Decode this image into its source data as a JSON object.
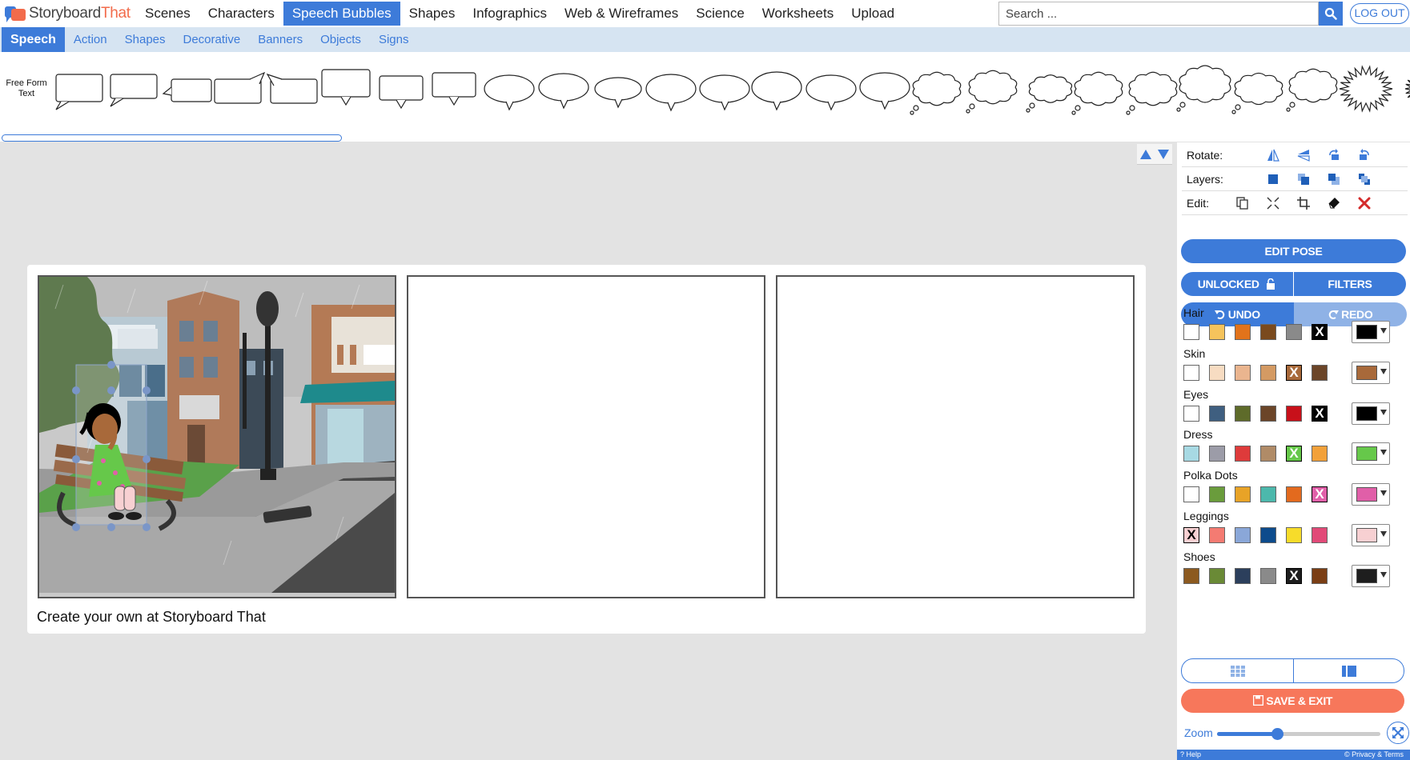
{
  "brand": {
    "name_part1": "Storyboard",
    "name_part2": "That"
  },
  "topnav": {
    "items": [
      "Scenes",
      "Characters",
      "Speech Bubbles",
      "Shapes",
      "Infographics",
      "Web & Wireframes",
      "Science",
      "Worksheets",
      "Upload"
    ],
    "active": "Speech Bubbles",
    "search_placeholder": "Search ...",
    "logout_label": "LOG OUT"
  },
  "subnav": {
    "items": [
      "Speech",
      "Action",
      "Shapes",
      "Decorative",
      "Banners",
      "Objects",
      "Signs"
    ],
    "active": "Speech"
  },
  "library": {
    "freeform_label": "Free Form Text"
  },
  "board": {
    "watermark": "Create your own at Storyboard That"
  },
  "panel": {
    "rotate_label": "Rotate:",
    "layers_label": "Layers:",
    "edit_label": "Edit:",
    "edit_pose": "EDIT POSE",
    "unlocked": "UNLOCKED",
    "filters": "FILTERS",
    "undo": "UNDO",
    "redo": "REDO",
    "save_exit": "SAVE & EXIT",
    "zoom_label": "Zoom",
    "zoom_level": 0.37,
    "help": "Help",
    "privacy": "© Privacy & Terms"
  },
  "colors": {
    "accent": "#3d7bd9",
    "save": "#f7775b",
    "groups": [
      {
        "label": "Hair",
        "swatches": [
          "#ffffff",
          "#f5c35c",
          "#e2731b",
          "#7a4a1e",
          "#8a8a8a",
          "#000000"
        ],
        "selected": 5,
        "current": "#000000"
      },
      {
        "label": "Skin",
        "swatches": [
          "#ffffff",
          "#f7dcc2",
          "#eab58f",
          "#d49a63",
          "#a8693a",
          "#6b4528"
        ],
        "selected": 4,
        "current": "#a8693a"
      },
      {
        "label": "Eyes",
        "swatches": [
          "#ffffff",
          "#3f5f80",
          "#5e6b2a",
          "#6b4528",
          "#c8101a",
          "#000000"
        ],
        "selected": 5,
        "current": "#000000"
      },
      {
        "label": "Dress",
        "swatches": [
          "#a7d9e3",
          "#9c9ca8",
          "#de3b3b",
          "#b08b67",
          "#66c84a",
          "#f2a13a"
        ],
        "selected": 4,
        "current": "#66c84a"
      },
      {
        "label": "Polka Dots",
        "swatches": [
          "#ffffff",
          "#6a9c3c",
          "#e8a327",
          "#4cb8ac",
          "#e36a1e",
          "#e05fa8"
        ],
        "selected": 5,
        "current": "#e05fa8"
      },
      {
        "label": "Leggings",
        "swatches": [
          "#f7d0d2",
          "#f47b72",
          "#8aa7d8",
          "#0d4b8c",
          "#f7dc2a",
          "#e14a78"
        ],
        "selected": 0,
        "current": "#f7d0d2"
      },
      {
        "label": "Shoes",
        "swatches": [
          "#8c5a20",
          "#6a8a36",
          "#2c3f5c",
          "#8a8a8a",
          "#1e1e1e",
          "#7a3e15"
        ],
        "selected": 4,
        "current": "#1e1e1e"
      }
    ]
  }
}
